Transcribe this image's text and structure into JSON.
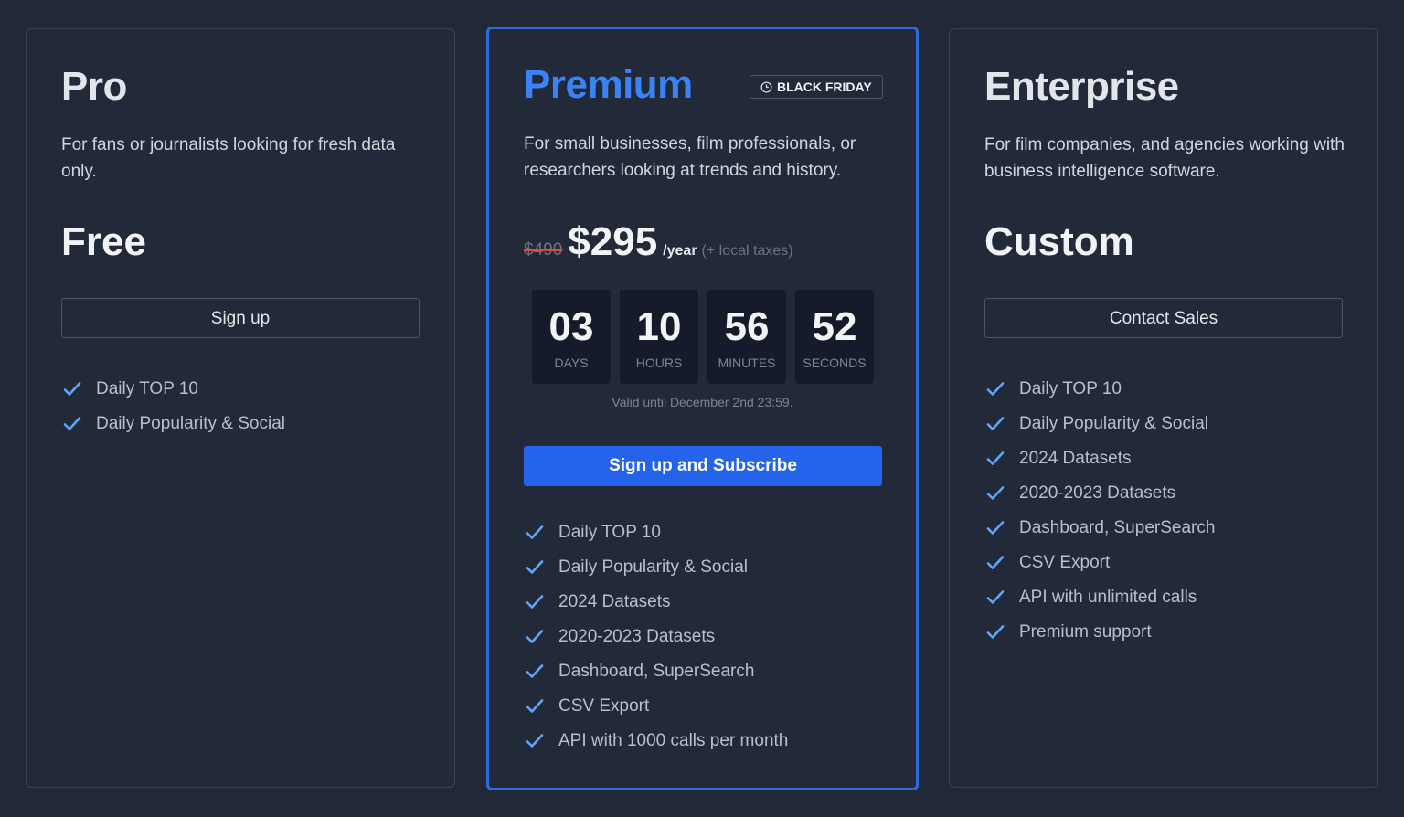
{
  "colors": {
    "accent": "#2563eb",
    "title_accent": "#3b82f6",
    "check": "#60a5fa",
    "strike": "#e0493f"
  },
  "plans": {
    "pro": {
      "title": "Pro",
      "description": "For fans or journalists looking for fresh data only.",
      "price": "Free",
      "button": "Sign up",
      "features": [
        "Daily TOP 10",
        "Daily Popularity & Social"
      ]
    },
    "premium": {
      "title": "Premium",
      "badge": {
        "icon": "clock-icon",
        "label": "BLACK FRIDAY"
      },
      "description": "For small businesses, film professionals, or researchers looking at trends and history.",
      "old_price": "$490",
      "price": "$295",
      "period": "/year",
      "tax_note": "(+ local taxes)",
      "countdown": [
        {
          "value": "03",
          "label": "DAYS"
        },
        {
          "value": "10",
          "label": "HOURS"
        },
        {
          "value": "56",
          "label": "MINUTES"
        },
        {
          "value": "52",
          "label": "SECONDS"
        }
      ],
      "valid_until": "Valid until December 2nd 23:59.",
      "button": "Sign up and Subscribe",
      "features": [
        "Daily TOP 10",
        "Daily Popularity & Social",
        "2024 Datasets",
        "2020-2023 Datasets",
        "Dashboard, SuperSearch",
        "CSV Export",
        "API with 1000 calls per month"
      ]
    },
    "enterprise": {
      "title": "Enterprise",
      "description": "For film companies, and agencies working with business intelligence software.",
      "price": "Custom",
      "button": "Contact Sales",
      "features": [
        "Daily TOP 10",
        "Daily Popularity & Social",
        "2024 Datasets",
        "2020-2023 Datasets",
        "Dashboard, SuperSearch",
        "CSV Export",
        "API with unlimited calls",
        "Premium support"
      ]
    }
  }
}
